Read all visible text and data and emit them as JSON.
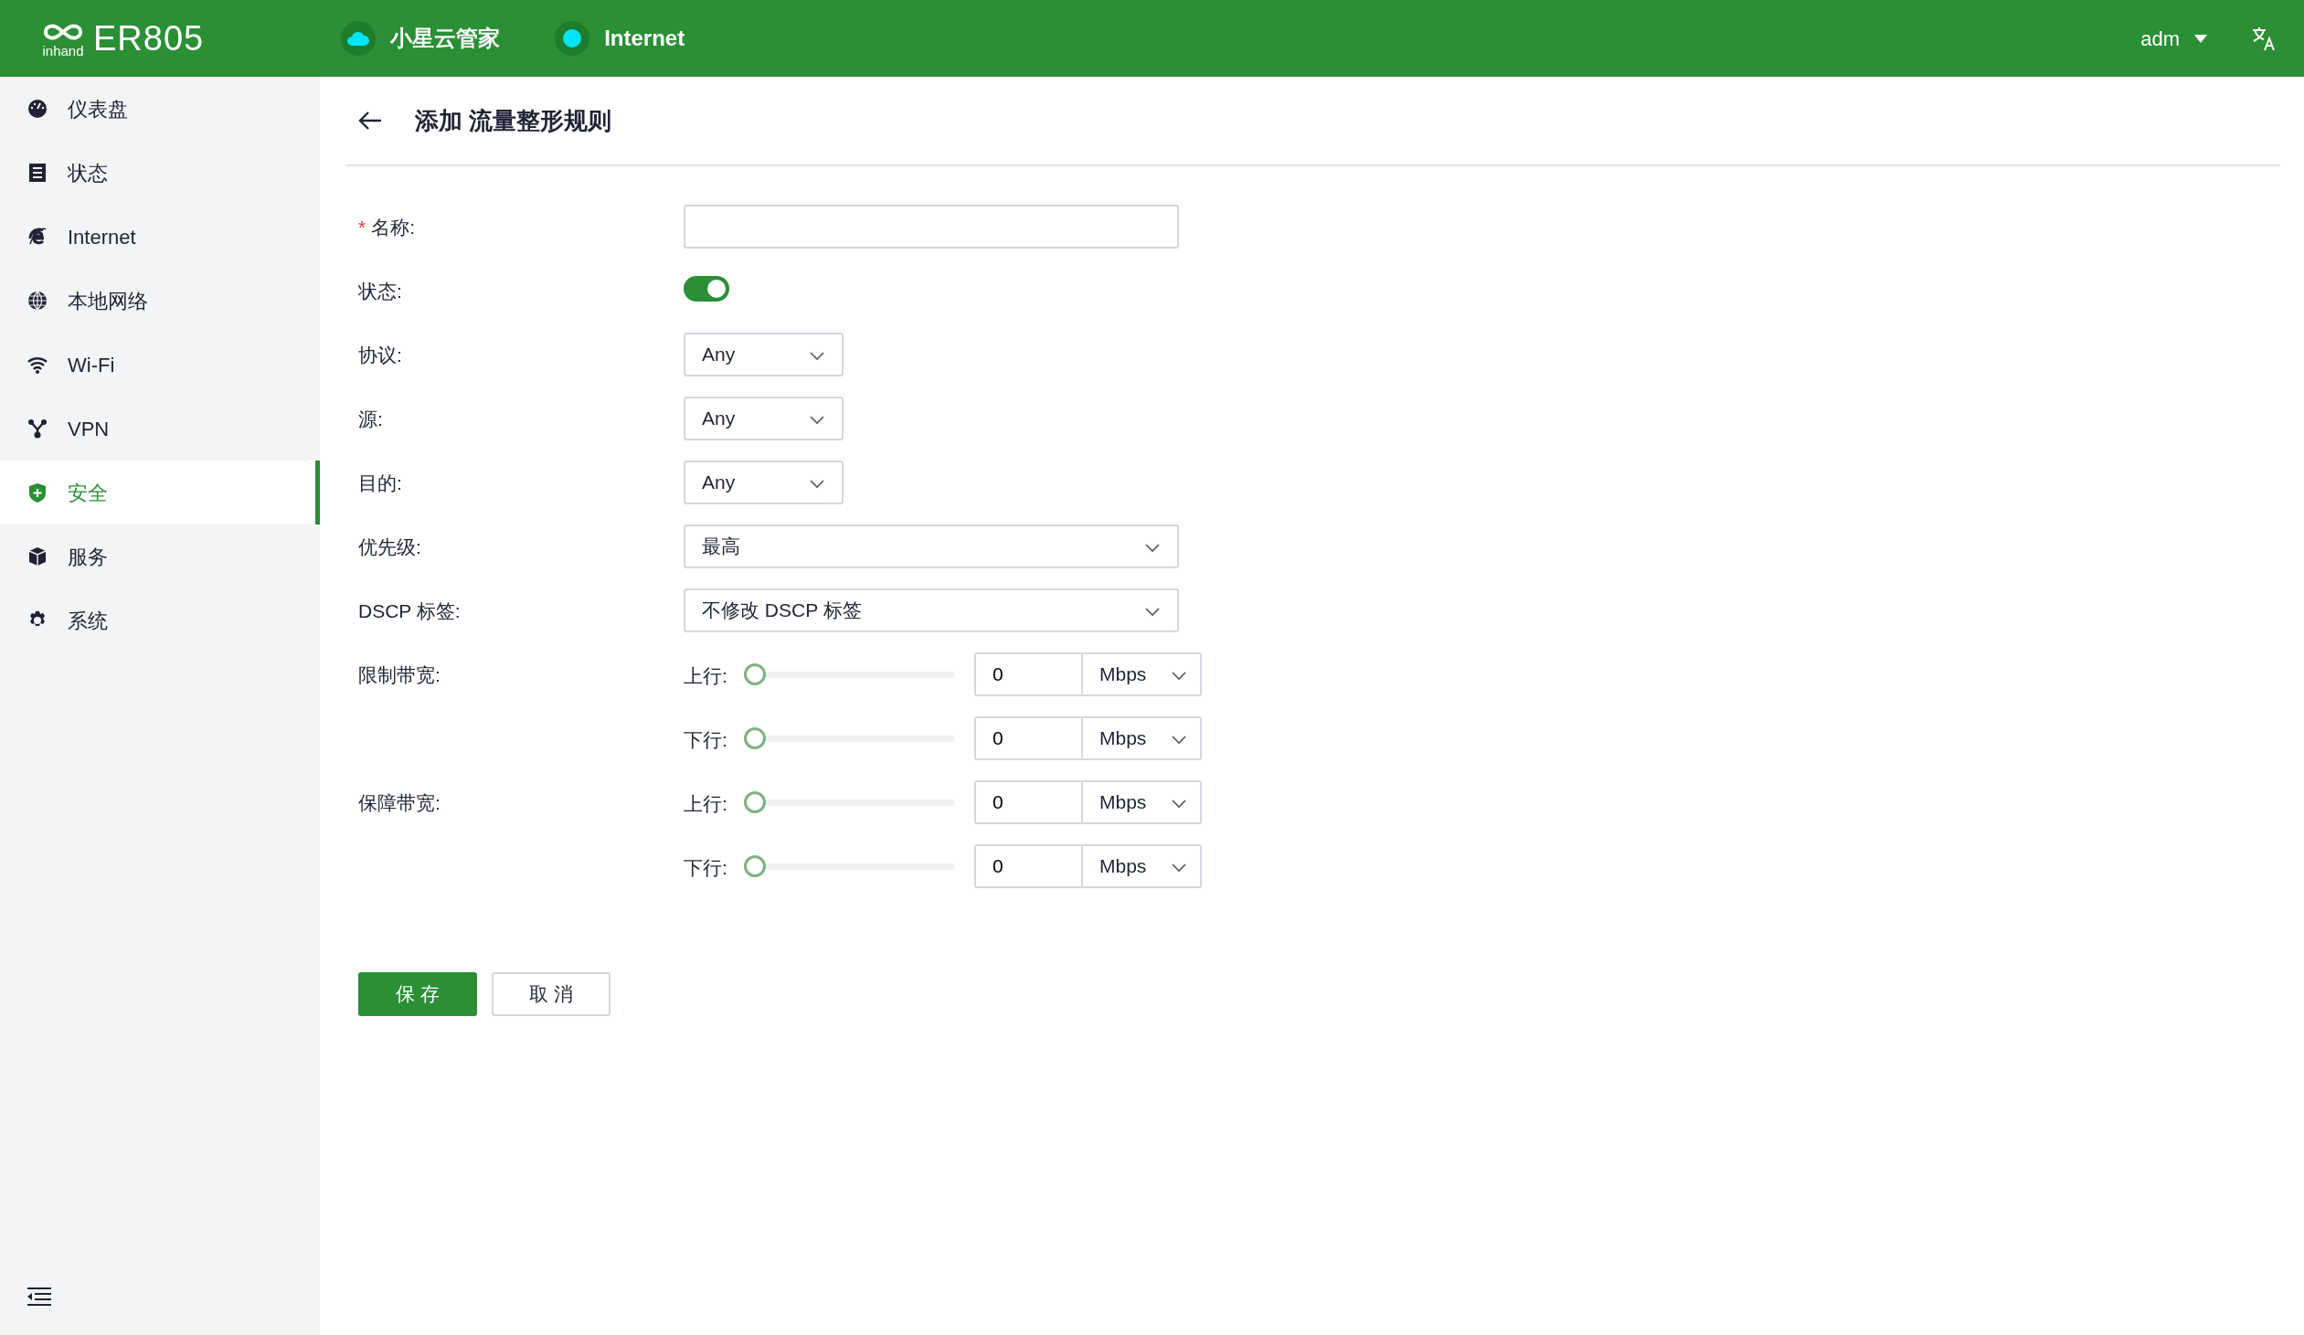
{
  "header": {
    "logo_word": "inhand",
    "product": "ER805",
    "status_items": [
      {
        "kind": "cloud",
        "label": "小星云管家"
      },
      {
        "kind": "dot",
        "label": "Internet"
      }
    ],
    "user": "adm"
  },
  "sidebar": {
    "items": [
      {
        "label": "仪表盘",
        "selected": false
      },
      {
        "label": "状态",
        "selected": false
      },
      {
        "label": "Internet",
        "selected": false
      },
      {
        "label": "本地网络",
        "selected": false
      },
      {
        "label": "Wi-Fi",
        "selected": false
      },
      {
        "label": "VPN",
        "selected": false
      },
      {
        "label": "安全",
        "selected": true
      },
      {
        "label": "服务",
        "selected": false
      },
      {
        "label": "系统",
        "selected": false
      }
    ]
  },
  "page": {
    "title": "添加 流量整形规则",
    "fields": [
      {
        "kind": "text",
        "label": "名称:",
        "required_mark": "*"
      },
      {
        "kind": "switch",
        "label": "状态:",
        "on": true
      },
      {
        "kind": "short_select",
        "label": "协议:",
        "value": "Any"
      },
      {
        "kind": "short_select",
        "label": "源:",
        "value": "Any"
      },
      {
        "kind": "short_select",
        "label": "目的:",
        "value": "Any"
      },
      {
        "kind": "select",
        "label": "优先级:",
        "value": "最高"
      },
      {
        "kind": "select",
        "label": "DSCP 标签:",
        "value": "不修改 DSCP 标签"
      },
      {
        "kind": "bandwidth",
        "label": "限制带宽:",
        "rows": [
          {
            "label": "上行:",
            "level": 0,
            "value": "0",
            "unit": "Mbps"
          },
          {
            "label": "下行:",
            "level": 0,
            "value": "0",
            "unit": "Mbps"
          }
        ]
      },
      {
        "kind": "bandwidth",
        "label": "保障带宽:",
        "rows": [
          {
            "label": "上行:",
            "level": 0,
            "value": "0",
            "unit": "Mbps"
          },
          {
            "label": "下行:",
            "level": 0,
            "value": "0",
            "unit": "Mbps"
          }
        ]
      }
    ],
    "buttons": [
      {
        "kind": "primary",
        "label": "保 存"
      },
      {
        "kind": "secondary",
        "label": "取 消"
      }
    ]
  }
}
